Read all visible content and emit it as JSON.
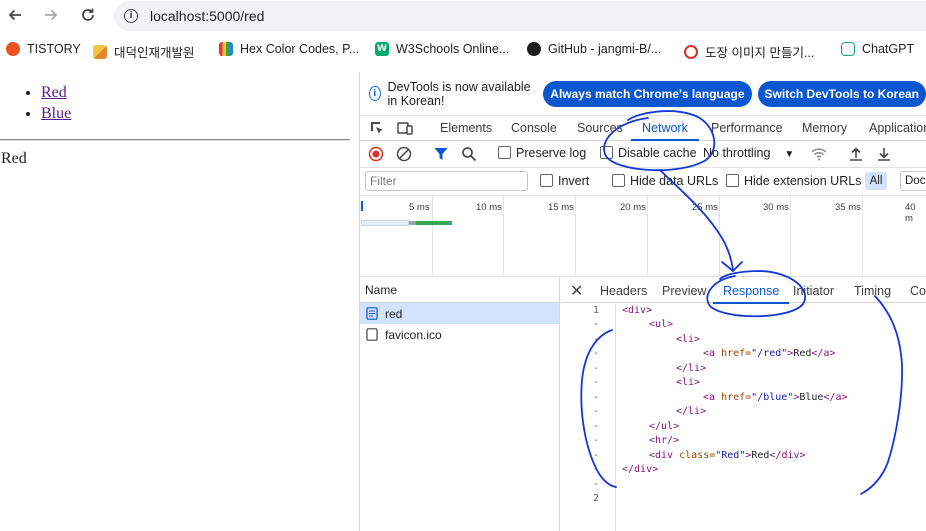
{
  "browser": {
    "url": "localhost:5000/red",
    "bookmarks": [
      {
        "label": "TISTORY",
        "color": "#eb531f"
      },
      {
        "label": "대덕인재개발원",
        "color": "#f0a12b"
      },
      {
        "label": "Hex Color Codes, P...",
        "color": "#e53935"
      },
      {
        "label": "W3Schools Online...",
        "color": "#04aa6d"
      },
      {
        "label": "GitHub - jangmi-B/...",
        "color": "#1f1f1f"
      },
      {
        "label": "도장 이미지 만들기...",
        "color": "#d93025"
      },
      {
        "label": "ChatGPT",
        "color": "#10a37f"
      }
    ]
  },
  "page": {
    "links": [
      "Red",
      "Blue"
    ],
    "result_text": "Red"
  },
  "devtools": {
    "infobar": {
      "message": "DevTools is now available in Korean!",
      "btn_match": "Always match Chrome's language",
      "btn_switch": "Switch DevTools to Korean"
    },
    "tabs": [
      "Elements",
      "Console",
      "Sources",
      "Network",
      "Performance",
      "Memory",
      "Application"
    ],
    "active_tab": "Network",
    "controls": {
      "preserve_log": "Preserve log",
      "disable_cache": "Disable cache",
      "throttling": "No throttling"
    },
    "filter": {
      "placeholder": "Filter",
      "invert": "Invert",
      "hide_data_urls": "Hide data URLs",
      "hide_extension_urls": "Hide extension URLs",
      "all": "All",
      "doc": "Doc"
    },
    "timeline_ticks": [
      "5 ms",
      "10 ms",
      "15 ms",
      "20 ms",
      "25 ms",
      "30 ms",
      "35 ms",
      "40 m"
    ],
    "requests_header": "Name",
    "requests": [
      {
        "name": "red",
        "selected": true
      },
      {
        "name": "favicon.ico",
        "selected": false
      }
    ],
    "detail_tabs": [
      "Headers",
      "Preview",
      "Response",
      "Initiator",
      "Timing",
      "Coo"
    ],
    "active_detail_tab": "Response",
    "line_numbers": [
      "1",
      "-",
      "-",
      "-",
      "-",
      "-",
      "-",
      "-",
      "-",
      "-",
      "-",
      "-",
      "-",
      "2"
    ],
    "code": {
      "l1": "<div>",
      "l2": "<ul>",
      "l3": "<li>",
      "l4_open": "<a ",
      "l4_attr": "href=",
      "l4_val": "\"/red\"",
      "l4_text": "Red",
      "l4_close": "</a>",
      "l5": "</li>",
      "l6": "<li>",
      "l7_open": "<a ",
      "l7_attr": "href=",
      "l7_val": "\"/blue\"",
      "l7_text": "Blue",
      "l7_close": "</a>",
      "l8": "</li>",
      "l9": "</ul>",
      "l10": "<hr/>",
      "l11_open": "<div ",
      "l11_attr": "class=",
      "l11_val": "\"Red\"",
      "l11_text": "Red",
      "l11_close": "</div>",
      "l12": "</div>"
    }
  }
}
